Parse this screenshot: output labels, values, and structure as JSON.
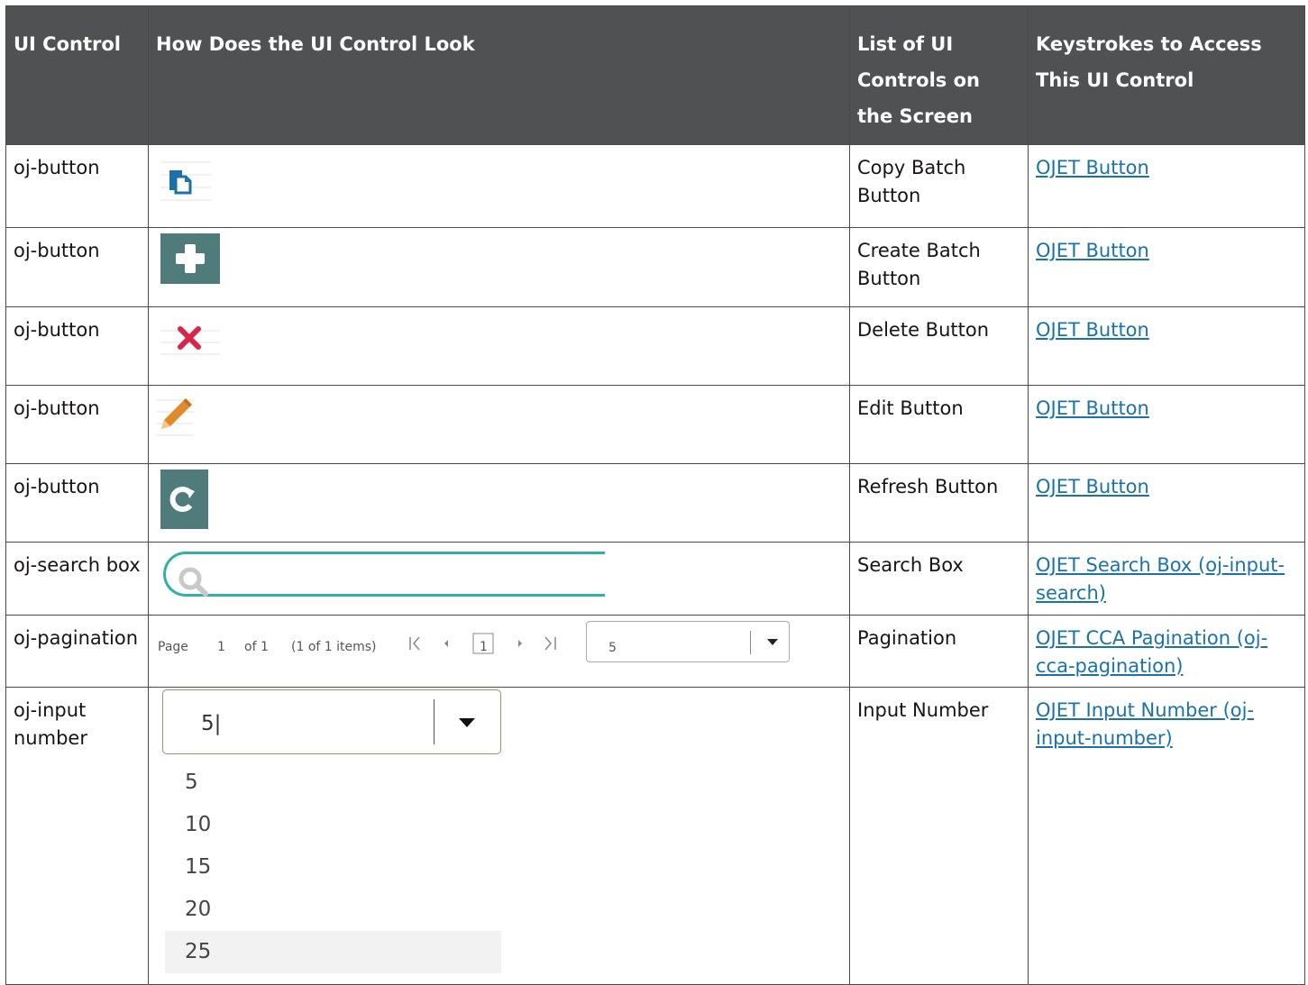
{
  "headers": [
    "UI Control",
    "How Does the UI Control Look",
    "List of UI Controls on the Screen",
    "Keystrokes to Access This UI Control"
  ],
  "rows": [
    {
      "control": "oj-button",
      "list": "Copy Batch Button",
      "link": "OJET Button",
      "look": "copy-icon"
    },
    {
      "control": "oj-button",
      "list": "Create Batch Button",
      "link": "OJET Button",
      "look": "plus-icon"
    },
    {
      "control": "oj-button",
      "list": "Delete Button",
      "link": "OJET Button",
      "look": "delete-x-icon"
    },
    {
      "control": "oj-button",
      "list": "Edit Button",
      "link": "OJET Button",
      "look": "pencil-icon"
    },
    {
      "control": "oj-button",
      "list": "Refresh Button",
      "link": "OJET Button",
      "look": "refresh-icon"
    },
    {
      "control": "oj-search box",
      "list": "Search Box",
      "link": "OJET Search Box (oj-input-search)",
      "look": "search-icon"
    },
    {
      "control": "oj-pagination",
      "list": "Pagination",
      "link": "OJET CCA Pagination (oj-cca-pagination)",
      "look": "pagination"
    },
    {
      "control": "oj-input number",
      "list": "Input Number",
      "link": "OJET Input Number (oj-input-number)",
      "look": "input-number"
    }
  ],
  "pagination": {
    "page_label": "Page",
    "page_value": "1",
    "of_label": "of 1",
    "items_label": "(1 of 1 items)",
    "current_page": "1",
    "page_size": "5"
  },
  "input_number": {
    "value": "5|",
    "options": [
      "5",
      "10",
      "15",
      "20",
      "25"
    ]
  },
  "colors": {
    "header_bg": "#4f5152",
    "link": "#1a73a8",
    "teal_button": "#4f7b7a",
    "search_outline": "#2fb0a8",
    "delete_red": "#d6264a",
    "pencil_orange": "#e08a2c",
    "copy_blue": "#1d6fa8"
  }
}
